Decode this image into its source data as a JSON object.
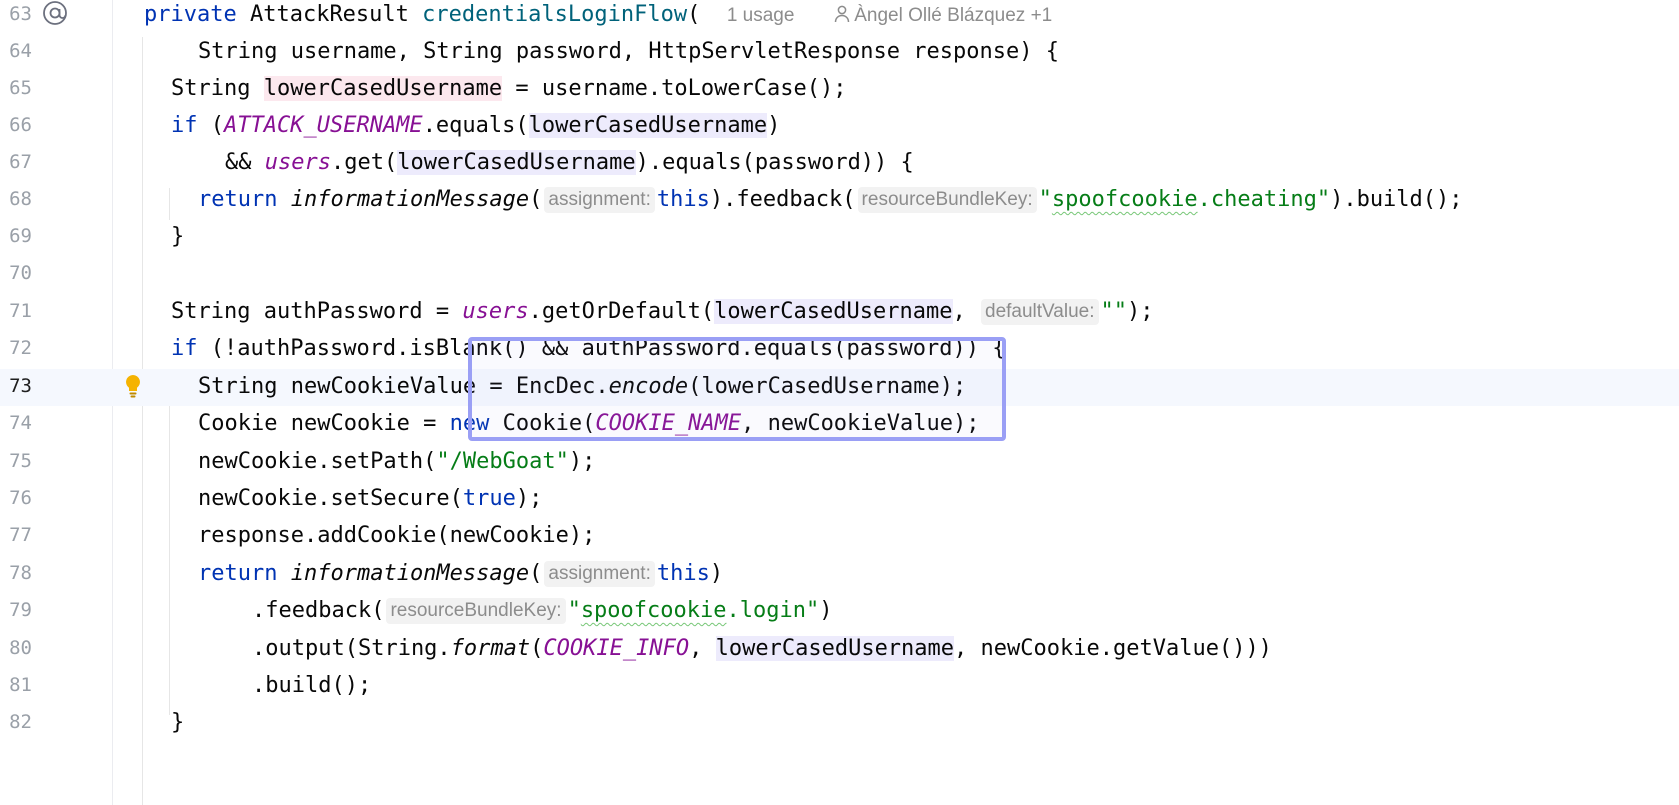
{
  "editor": {
    "colors": {
      "keyword": "#0033b3",
      "method_decl": "#00627a",
      "constant": "#871094",
      "string": "#067d17",
      "line_highlight": "#f5f8fe",
      "selection_box": "#9a9ff5"
    },
    "line_numbers": [
      "63",
      "64",
      "65",
      "66",
      "67",
      "68",
      "69",
      "70",
      "71",
      "72",
      "73",
      "74",
      "75",
      "76",
      "77",
      "78",
      "79",
      "80",
      "81",
      "82"
    ],
    "current_line": "73",
    "gutter_icons": {
      "line63": "at-icon",
      "line73": "lightbulb-icon"
    },
    "l63": {
      "private": "private",
      "type": "AttackResult",
      "name": "credentialsLoginFlow",
      "paren": "(",
      "usages": "1 usage",
      "author": "Àngel Ollé Blázquez +1"
    },
    "l64": {
      "text": "String username, String password, HttpServletResponse response) {"
    },
    "l65": {
      "a": "String ",
      "b": "lowerCasedUsername",
      "c": " = username.toLowerCase();"
    },
    "l66": {
      "kw": "if",
      "a": " (",
      "const": "ATTACK_USERNAME",
      "b": ".equals(",
      "var": "lowerCasedUsername",
      "c": ")"
    },
    "l67": {
      "a": "&& ",
      "field": "users",
      "b": ".get(",
      "var": "lowerCasedUsername",
      "c": ").equals(password)) {"
    },
    "l68": {
      "kw": "return",
      "fn": "informationMessage",
      "a": "(",
      "hint1": "assignment:",
      "this": "this",
      "b": ").feedback(",
      "hint2": "resourceBundleKey:",
      "q1": "\"",
      "str": "spoofcookie",
      "str2": ".cheating",
      "q2": "\"",
      "c": ").build();"
    },
    "l69": {
      "text": "}"
    },
    "l71": {
      "a": "String authPassword = ",
      "field": "users",
      "b": ".getOrDefault(",
      "var": "lowerCasedUsername",
      "c": ", ",
      "hint": "defaultValue:",
      "str": "\"\"",
      "d": ");"
    },
    "l72": {
      "kw": "if",
      "a": " (!authPassword.isBlank() && authPassword.equals(password)) {"
    },
    "l73": {
      "a": "String newCookieValue = EncDec.",
      "fn": "encode",
      "b": "(lowerCasedUsername);"
    },
    "l74": {
      "a": "Cookie newCookie = ",
      "kw": "new",
      "b": " Cookie(",
      "const": "COOKIE_NAME",
      "c": ", newCookieValue);"
    },
    "l75": {
      "a": "newCookie.setPath(",
      "str": "\"/WebGoat\"",
      "b": ");"
    },
    "l76": {
      "a": "newCookie.setSecure(",
      "kw": "true",
      "b": ");"
    },
    "l77": {
      "text": "response.addCookie(newCookie);"
    },
    "l78": {
      "kw": "return",
      "fn": "informationMessage",
      "a": "(",
      "hint": "assignment:",
      "this": "this",
      "b": ")"
    },
    "l79": {
      "a": ".feedback(",
      "hint": "resourceBundleKey:",
      "q1": "\"",
      "str": "spoofcookie",
      "str2": ".login",
      "q2": "\"",
      "b": ")"
    },
    "l80": {
      "a": ".output(String.",
      "fn": "format",
      "b": "(",
      "const": "COOKIE_INFO",
      "c": ", ",
      "var": "lowerCasedUsername",
      "d": ", newCookie.getValue()))"
    },
    "l81": {
      "text": ".build();"
    },
    "l82": {
      "text": "}"
    }
  }
}
